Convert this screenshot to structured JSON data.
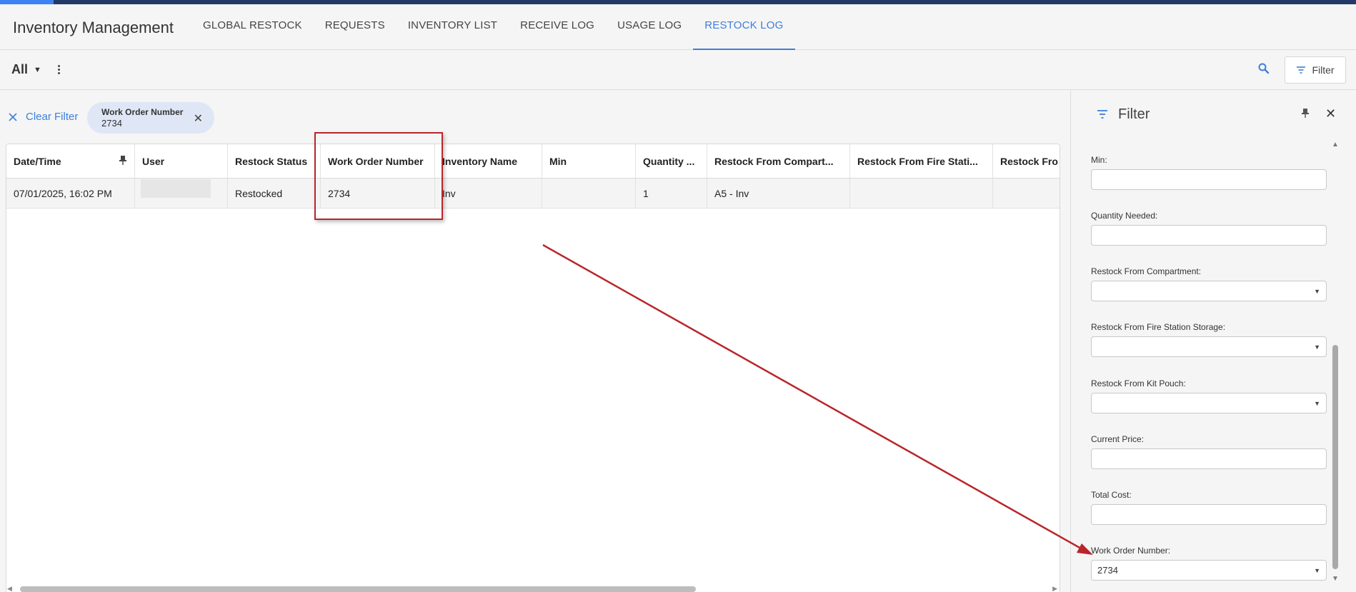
{
  "app": {
    "title": "Inventory Management"
  },
  "nav": {
    "tabs": [
      {
        "label": "GLOBAL RESTOCK"
      },
      {
        "label": "REQUESTS"
      },
      {
        "label": "INVENTORY LIST"
      },
      {
        "label": "RECEIVE LOG"
      },
      {
        "label": "USAGE LOG"
      },
      {
        "label": "RESTOCK LOG"
      }
    ],
    "active": "RESTOCK LOG"
  },
  "toolbar": {
    "view": "All",
    "filter_label": "Filter"
  },
  "filters": {
    "clear_label": "Clear Filter",
    "chip": {
      "title": "Work Order Number",
      "value": "2734"
    }
  },
  "grid": {
    "columns": [
      "Date/Time",
      "User",
      "Restock Status",
      "Work Order Number",
      "Inventory Name",
      "Min",
      "Quantity ...",
      "Restock From Compart...",
      "Restock From Fire Stati...",
      "Restock Fro"
    ],
    "rows": [
      {
        "date_time": "07/01/2025, 16:02 PM",
        "user": "",
        "restock_status": "Restocked",
        "work_order_number": "2734",
        "inventory_name": "Inv",
        "min": "",
        "quantity": "1",
        "restock_from_compartment": "A5 - Inv",
        "restock_from_fire_station": "",
        "restock_from": ""
      }
    ]
  },
  "filter_panel": {
    "title": "Filter",
    "fields": [
      {
        "label": "Min:",
        "value": "",
        "type": "text"
      },
      {
        "label": "Quantity Needed:",
        "value": "",
        "type": "text"
      },
      {
        "label": "Restock From Compartment:",
        "value": "",
        "type": "select"
      },
      {
        "label": "Restock From Fire Station Storage:",
        "value": "",
        "type": "select"
      },
      {
        "label": "Restock From Kit Pouch:",
        "value": "",
        "type": "select"
      },
      {
        "label": "Current Price:",
        "value": "",
        "type": "text"
      },
      {
        "label": "Total Cost:",
        "value": "",
        "type": "text"
      },
      {
        "label": "Work Order Number:",
        "value": "2734",
        "type": "select"
      }
    ]
  },
  "colors": {
    "accent": "#3d7fd9",
    "top_bar": "#243a66",
    "annotation": "#b8262b",
    "chip_bg": "#dfe7f6"
  }
}
